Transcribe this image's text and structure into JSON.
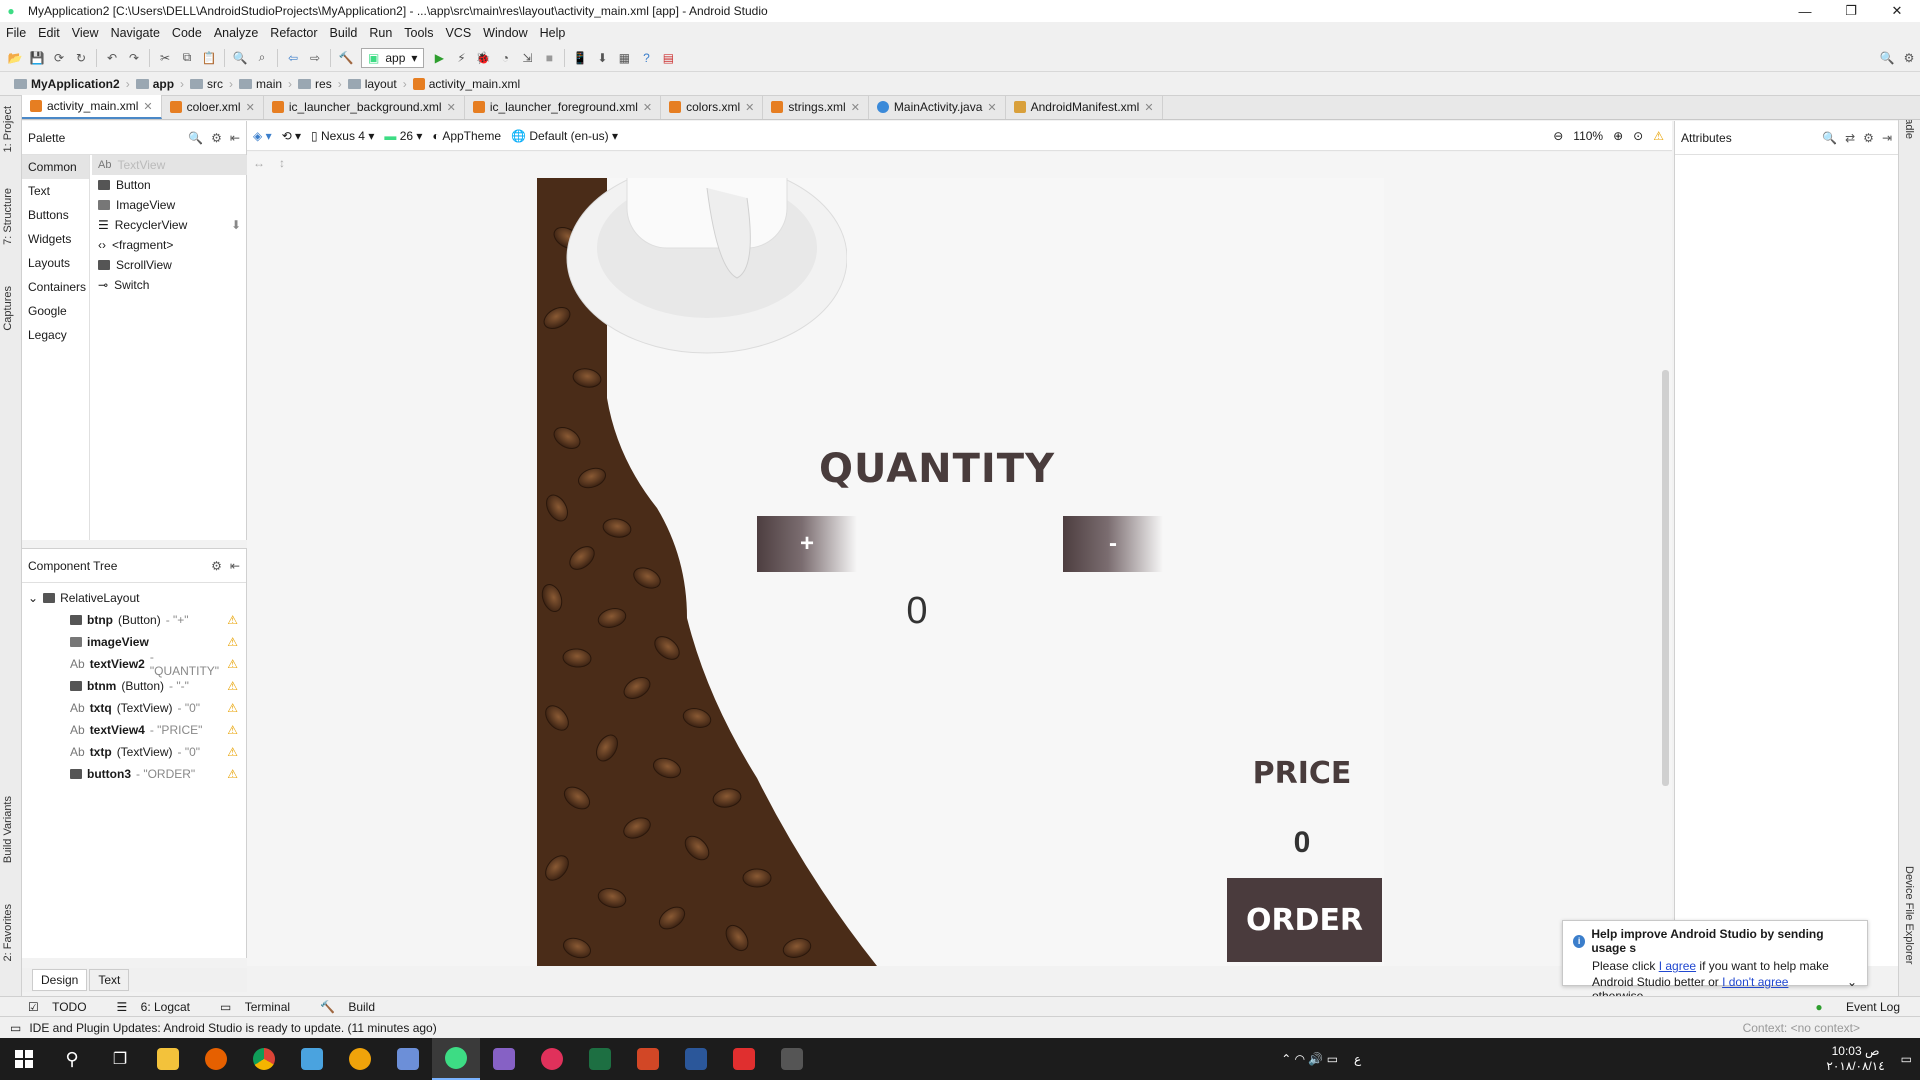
{
  "window": {
    "title": "MyApplication2 [C:\\Users\\DELL\\AndroidStudioProjects\\MyApplication2] - ...\\app\\src\\main\\res\\layout\\activity_main.xml [app] - Android Studio"
  },
  "menu": [
    "File",
    "Edit",
    "View",
    "Navigate",
    "Code",
    "Analyze",
    "Refactor",
    "Build",
    "Run",
    "Tools",
    "VCS",
    "Window",
    "Help"
  ],
  "toolbar": {
    "run_config": "app"
  },
  "breadcrumb": [
    "MyApplication2",
    "app",
    "src",
    "main",
    "res",
    "layout",
    "activity_main.xml"
  ],
  "tabs": [
    {
      "label": "activity_main.xml",
      "color": "#e67e22"
    },
    {
      "label": "coloer.xml",
      "color": "#e67e22"
    },
    {
      "label": "ic_launcher_background.xml",
      "color": "#e67e22"
    },
    {
      "label": "ic_launcher_foreground.xml",
      "color": "#e67e22"
    },
    {
      "label": "colors.xml",
      "color": "#e67e22"
    },
    {
      "label": "strings.xml",
      "color": "#e67e22"
    },
    {
      "label": "MainActivity.java",
      "color": "#3b8ad9"
    },
    {
      "label": "AndroidManifest.xml",
      "color": "#d9a03b"
    }
  ],
  "left_strip": [
    "1: Project",
    "7: Structure",
    "Captures",
    "Build Variants",
    "2: Favorites"
  ],
  "right_strip": [
    "Gradle",
    "Device File Explorer"
  ],
  "palette": {
    "title": "Palette",
    "categories": [
      "Common",
      "Text",
      "Buttons",
      "Widgets",
      "Layouts",
      "Containers",
      "Google",
      "Legacy"
    ],
    "items": [
      "TextView",
      "Button",
      "ImageView",
      "RecyclerView",
      "<fragment>",
      "ScrollView",
      "Switch"
    ],
    "textview_prefix": "Ab"
  },
  "component_tree": {
    "title": "Component Tree",
    "root": "RelativeLayout",
    "nodes": [
      {
        "id": "btnp",
        "type": "(Button)",
        "text": "- \"+\""
      },
      {
        "id": "imageView",
        "type": "",
        "text": ""
      },
      {
        "id": "textView2",
        "type": "",
        "text": "- \"QUANTITY\""
      },
      {
        "id": "btnm",
        "type": "(Button)",
        "text": "- \"-\""
      },
      {
        "id": "txtq",
        "type": "(TextView)",
        "text": "- \"0\""
      },
      {
        "id": "textView4",
        "type": "",
        "text": "- \"PRICE\""
      },
      {
        "id": "txtp",
        "type": "(TextView)",
        "text": "- \"0\""
      },
      {
        "id": "button3",
        "type": "",
        "text": "- \"ORDER\""
      }
    ]
  },
  "design_tabs": [
    "Design",
    "Text"
  ],
  "design_toolbar": {
    "device": "Nexus 4",
    "api": "26",
    "theme": "AppTheme",
    "locale": "Default (en-us)",
    "zoom": "110%"
  },
  "attributes": {
    "title": "Attributes"
  },
  "app": {
    "quantity_label": "QUANTITY",
    "plus": "+",
    "minus": "-",
    "quantity_value": "0",
    "price_label": "PRICE",
    "price_value": "0",
    "order": "ORDER"
  },
  "notification": {
    "title": "Help improve Android Studio by sending usage s",
    "line1_pre": "Please click ",
    "agree": "I agree",
    "line1_post": " if you want to help make",
    "line2_pre": "Android Studio better or ",
    "disagree": "I don't agree",
    "line2_post": " otherwise..."
  },
  "bottom_tools": [
    "TODO",
    "6: Logcat",
    "Terminal",
    "Build"
  ],
  "event_log": "Event Log",
  "status": {
    "message": "IDE and Plugin Updates: Android Studio is ready to update. (11 minutes ago)",
    "context": "Context: <no context>"
  },
  "taskbar": {
    "time": "10:03 ص",
    "date": "٢٠١٨/٠٨/١٤",
    "lang": "ع"
  }
}
